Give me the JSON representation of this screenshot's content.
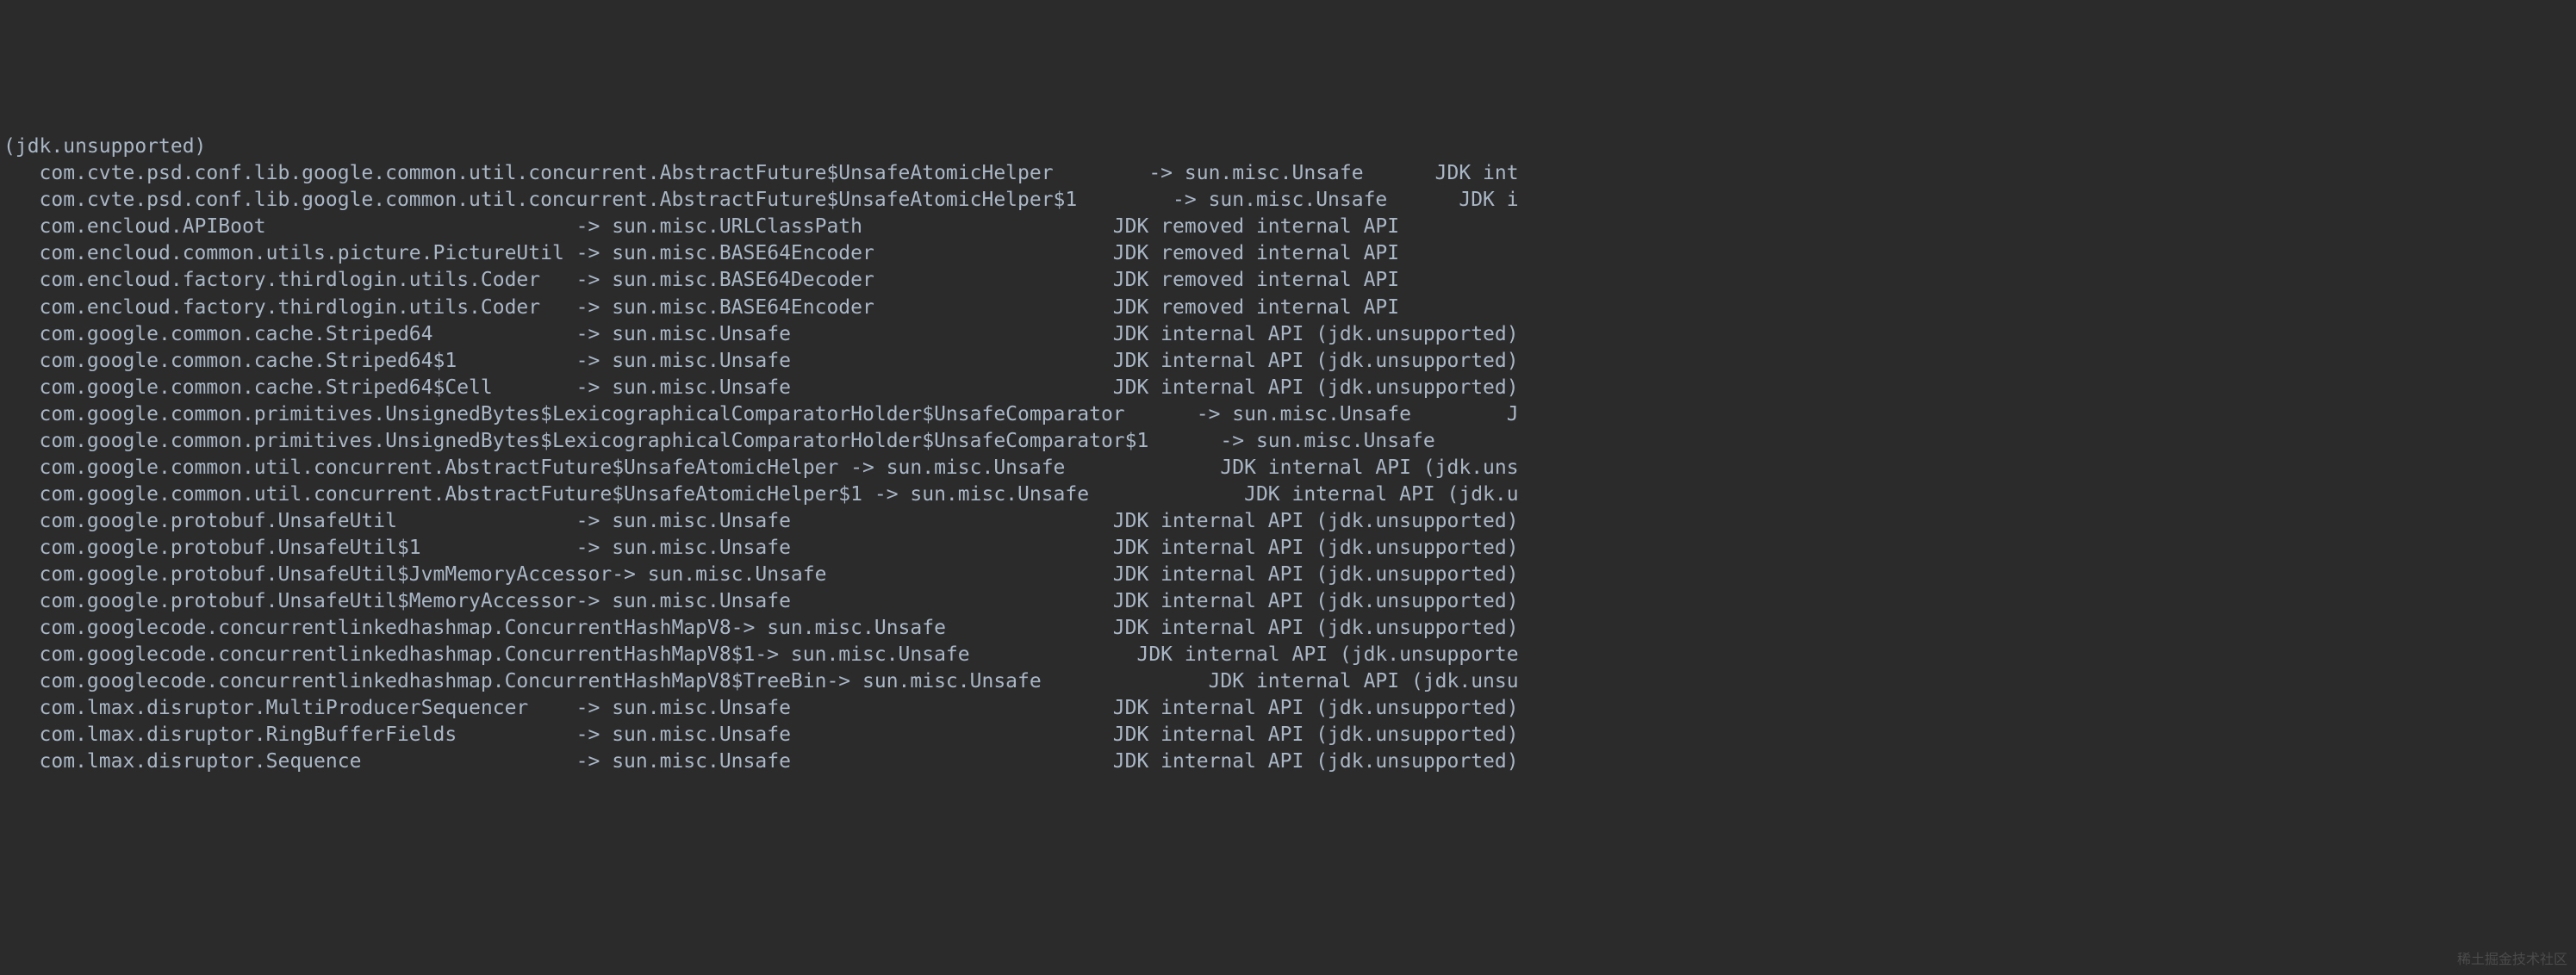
{
  "header": "(jdk.unsupported)",
  "lines": [
    {
      "source": "com.cvte.psd.conf.lib.google.common.util.concurrent.AbstractFuture$UnsafeAtomicHelper",
      "target": "sun.misc.Unsafe",
      "note": "JDK int",
      "col1_width": 93,
      "align_note_right": true,
      "right_offset": 0
    },
    {
      "source": "com.cvte.psd.conf.lib.google.common.util.concurrent.AbstractFuture$UnsafeAtomicHelper$1",
      "target": "sun.misc.Unsafe",
      "note": "JDK i",
      "col1_width": 95,
      "align_note_right": true,
      "right_offset": 0
    },
    {
      "source": "com.encloud.APIBoot",
      "target": "sun.misc.URLClassPath",
      "note": "JDK removed internal API",
      "col1_width": 45,
      "note_col": 90
    },
    {
      "source": "com.encloud.common.utils.picture.PictureUtil",
      "target": "sun.misc.BASE64Encoder",
      "note": "JDK removed internal API",
      "col1_width": 45,
      "note_col": 90
    },
    {
      "source": "com.encloud.factory.thirdlogin.utils.Coder",
      "target": "sun.misc.BASE64Decoder",
      "note": "JDK removed internal API",
      "col1_width": 45,
      "note_col": 90
    },
    {
      "source": "com.encloud.factory.thirdlogin.utils.Coder",
      "target": "sun.misc.BASE64Encoder",
      "note": "JDK removed internal API",
      "col1_width": 45,
      "note_col": 90
    },
    {
      "source": "com.google.common.cache.Striped64",
      "target": "sun.misc.Unsafe",
      "note": "JDK internal API (jdk.unsupported)",
      "col1_width": 45,
      "note_col": 90
    },
    {
      "source": "com.google.common.cache.Striped64$1",
      "target": "sun.misc.Unsafe",
      "note": "JDK internal API (jdk.unsupported)",
      "col1_width": 45,
      "note_col": 90
    },
    {
      "source": "com.google.common.cache.Striped64$Cell",
      "target": "sun.misc.Unsafe",
      "note": "JDK internal API (jdk.unsupported)",
      "col1_width": 45,
      "note_col": 90
    },
    {
      "source": "com.google.common.primitives.UnsignedBytes$LexicographicalComparatorHolder$UnsafeComparator",
      "target": "sun.misc.Unsafe",
      "note": "J",
      "col1_width": 97,
      "align_note_right": true,
      "right_offset": 0
    },
    {
      "source": "com.google.common.primitives.UnsignedBytes$LexicographicalComparatorHolder$UnsafeComparator$1",
      "target": "sun.misc.Unsafe",
      "note": "",
      "col1_width": 99
    },
    {
      "source": "com.google.common.util.concurrent.AbstractFuture$UnsafeAtomicHelper",
      "target": "sun.misc.Unsafe",
      "note": "JDK internal API (jdk.uns",
      "col1_width": 68,
      "align_note_right": true,
      "right_offset": 0
    },
    {
      "source": "com.google.common.util.concurrent.AbstractFuture$UnsafeAtomicHelper$1",
      "target": "sun.misc.Unsafe",
      "note": "JDK internal API (jdk.u",
      "col1_width": 70,
      "align_note_right": true,
      "right_offset": 0
    },
    {
      "source": "com.google.protobuf.UnsafeUtil",
      "target": "sun.misc.Unsafe",
      "note": "JDK internal API (jdk.unsupported)",
      "col1_width": 45,
      "note_col": 90
    },
    {
      "source": "com.google.protobuf.UnsafeUtil$1",
      "target": "sun.misc.Unsafe",
      "note": "JDK internal API (jdk.unsupported)",
      "col1_width": 45,
      "note_col": 90
    },
    {
      "source": "com.google.protobuf.UnsafeUtil$JvmMemoryAccessor",
      "target": "sun.misc.Unsafe",
      "note": "JDK internal API (jdk.unsupported)",
      "col1_width": 45,
      "note_col": 90
    },
    {
      "source": "com.google.protobuf.UnsafeUtil$MemoryAccessor",
      "target": "sun.misc.Unsafe",
      "note": "JDK internal API (jdk.unsupported)",
      "col1_width": 45,
      "note_col": 90
    },
    {
      "source": "com.googlecode.concurrentlinkedhashmap.ConcurrentHashMapV8",
      "target": "sun.misc.Unsafe",
      "note": "JDK internal API (jdk.unsupported)",
      "col1_width": 58,
      "align_note_right": true,
      "right_offset": 0
    },
    {
      "source": "com.googlecode.concurrentlinkedhashmap.ConcurrentHashMapV8$1",
      "target": "sun.misc.Unsafe",
      "note": "JDK internal API (jdk.unsupporte",
      "col1_width": 60,
      "align_note_right": true,
      "right_offset": 0
    },
    {
      "source": "com.googlecode.concurrentlinkedhashmap.ConcurrentHashMapV8$TreeBin",
      "target": "sun.misc.Unsafe",
      "note": "JDK internal API (jdk.unsu",
      "col1_width": 66,
      "align_note_right": true,
      "right_offset": 0
    },
    {
      "source": "com.lmax.disruptor.MultiProducerSequencer",
      "target": "sun.misc.Unsafe",
      "note": "JDK internal API (jdk.unsupported)",
      "col1_width": 45,
      "note_col": 90
    },
    {
      "source": "com.lmax.disruptor.RingBufferFields",
      "target": "sun.misc.Unsafe",
      "note": "JDK internal API (jdk.unsupported)",
      "col1_width": 45,
      "note_col": 90
    },
    {
      "source": "com.lmax.disruptor.Sequence",
      "target": "sun.misc.Unsafe",
      "note": "JDK internal API (jdk.unsupported)",
      "col1_width": 45,
      "note_col": 90
    }
  ],
  "watermark": "稀土掘金技术社区",
  "indent": "   ",
  "arrow": "->",
  "total_width_chars": 127
}
